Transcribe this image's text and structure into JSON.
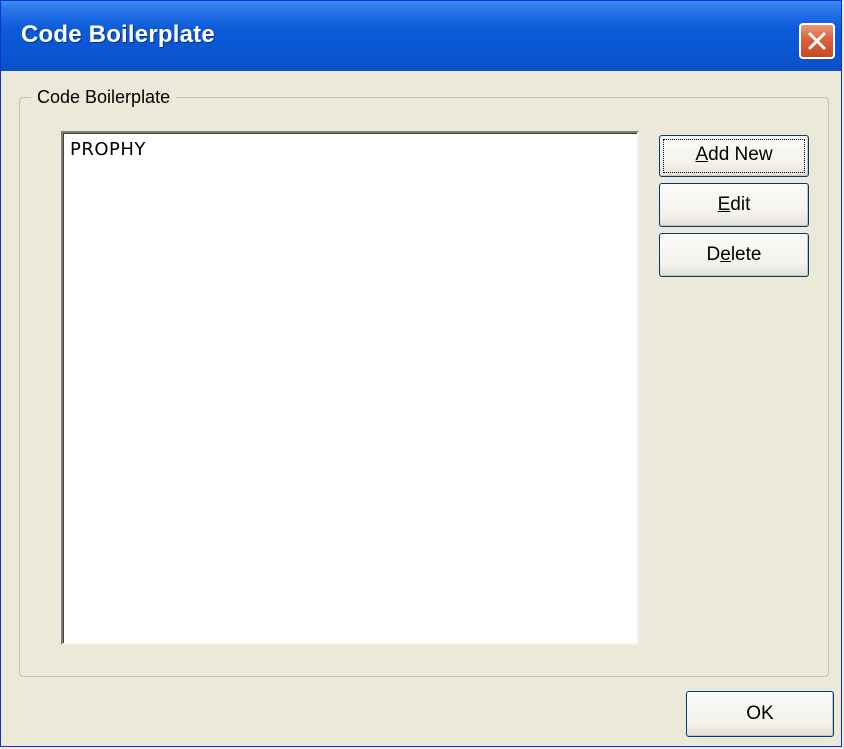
{
  "window": {
    "title": "Code Boilerplate",
    "close_icon": "close-icon"
  },
  "group": {
    "label": "Code Boilerplate"
  },
  "list": {
    "items": [
      "PROPHY"
    ]
  },
  "buttons": {
    "add_new": {
      "mnemonic": "A",
      "rest": "dd New"
    },
    "edit": {
      "mnemonic": "E",
      "rest": "dit"
    },
    "delete": {
      "pre": "D",
      "mnemonic": "e",
      "rest": "lete"
    },
    "ok": "OK"
  },
  "colors": {
    "titlebar": "#0b5bd8",
    "dialog_bg": "#ece9d8",
    "close_button": "#d9613c"
  }
}
